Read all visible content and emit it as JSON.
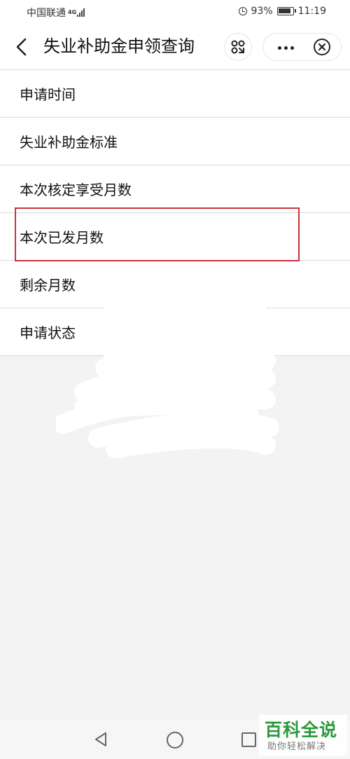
{
  "status_bar": {
    "carrier": "中国联通",
    "network": "4G",
    "battery": "93%",
    "time": "11:19",
    "icons": [
      "signal-icon",
      "alarm-icon",
      "battery-icon"
    ]
  },
  "nav": {
    "title": "失业补助金申领查询",
    "icons": [
      "back-arrow-icon",
      "scan-icon",
      "more-dots-icon",
      "close-circle-icon"
    ]
  },
  "list": {
    "items": [
      {
        "label": "申请时间"
      },
      {
        "label": "失业补助金标准"
      },
      {
        "label": "本次核定享受月数"
      },
      {
        "label": "本次已发月数",
        "highlighted": true
      },
      {
        "label": "剩余月数"
      },
      {
        "label": "申请状态"
      }
    ]
  },
  "colors": {
    "highlight_border": "#c8333b",
    "watermark_green": "#2b9a3c"
  },
  "watermark": {
    "title": "百科全说",
    "subtitle": "助你轻松解决"
  }
}
